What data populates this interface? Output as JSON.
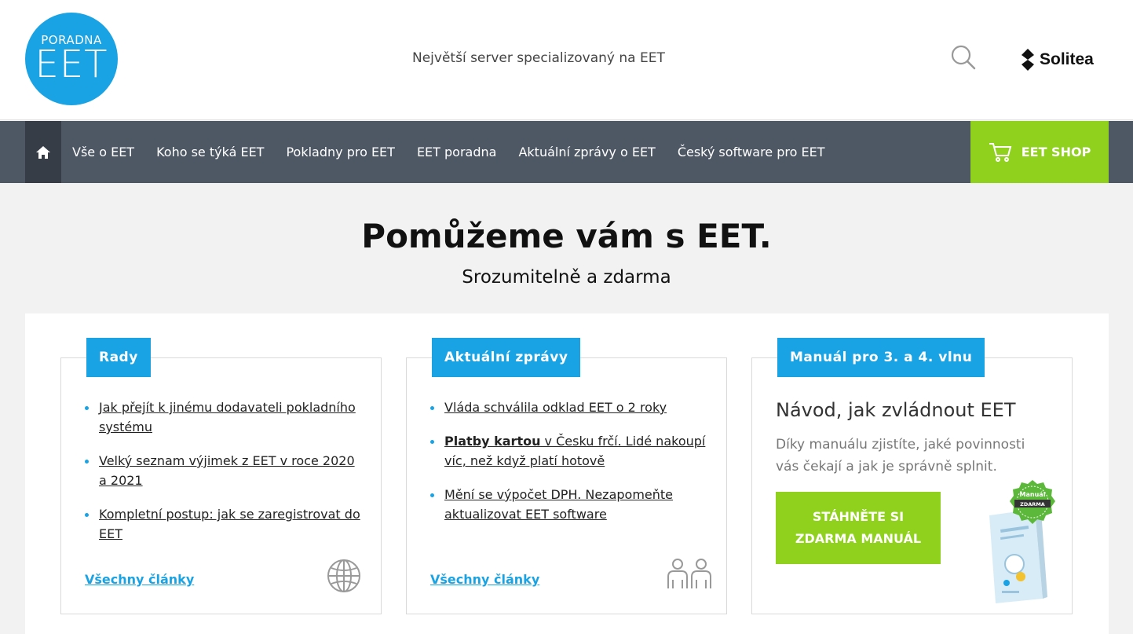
{
  "header": {
    "logo_small": "PORADNA",
    "logo_big": "EET",
    "tagline": "Největší server specializovaný na EET",
    "brand": "Solitea"
  },
  "nav": {
    "items": [
      "Vše o EET",
      "Koho se týká EET",
      "Pokladny pro EET",
      "EET poradna",
      "Aktuální zprávy o EET",
      "Český software pro EET"
    ],
    "shop_label": "EET SHOP"
  },
  "hero": {
    "title": "Pomůžeme vám s EET.",
    "subtitle": "Srozumitelně a zdarma"
  },
  "cards": {
    "rady": {
      "tag": "Rady",
      "items": [
        "Jak přejít k jinému dodavateli pokladního systému",
        "Velký seznam výjimek z EET v roce 2020 a 2021",
        "Kompletní postup: jak se zaregistrovat do EET"
      ],
      "all_link": "Všechny články"
    },
    "zpravy": {
      "tag": "Aktuální zprávy",
      "item0": "Vláda schválila odklad EET o 2 roky",
      "item1_bold": "Platby kartou",
      "item1_rest": " v Česku frčí. Lidé nakoupí víc, než když platí hotově",
      "item2": "Mění se výpočet DPH. Nezapomeňte aktualizovat EET software",
      "all_link": "Všechny články"
    },
    "manual": {
      "tag": "Manuál pro 3. a 4. vlnu",
      "title": "Návod, jak zvládnout EET",
      "text": "Díky manuálu zjistíte, jaké povinnosti vás čekají a jak je správně splnit.",
      "button_line1": "STÁHNĚTE SI",
      "button_line2": "ZDARMA MANUÁL",
      "badge_line1": "Manuál",
      "badge_line2": "ZDARMA"
    }
  },
  "colors": {
    "brand_blue": "#1aa3e4",
    "nav_bg": "#4e5865",
    "accent_green": "#8fd11c"
  }
}
